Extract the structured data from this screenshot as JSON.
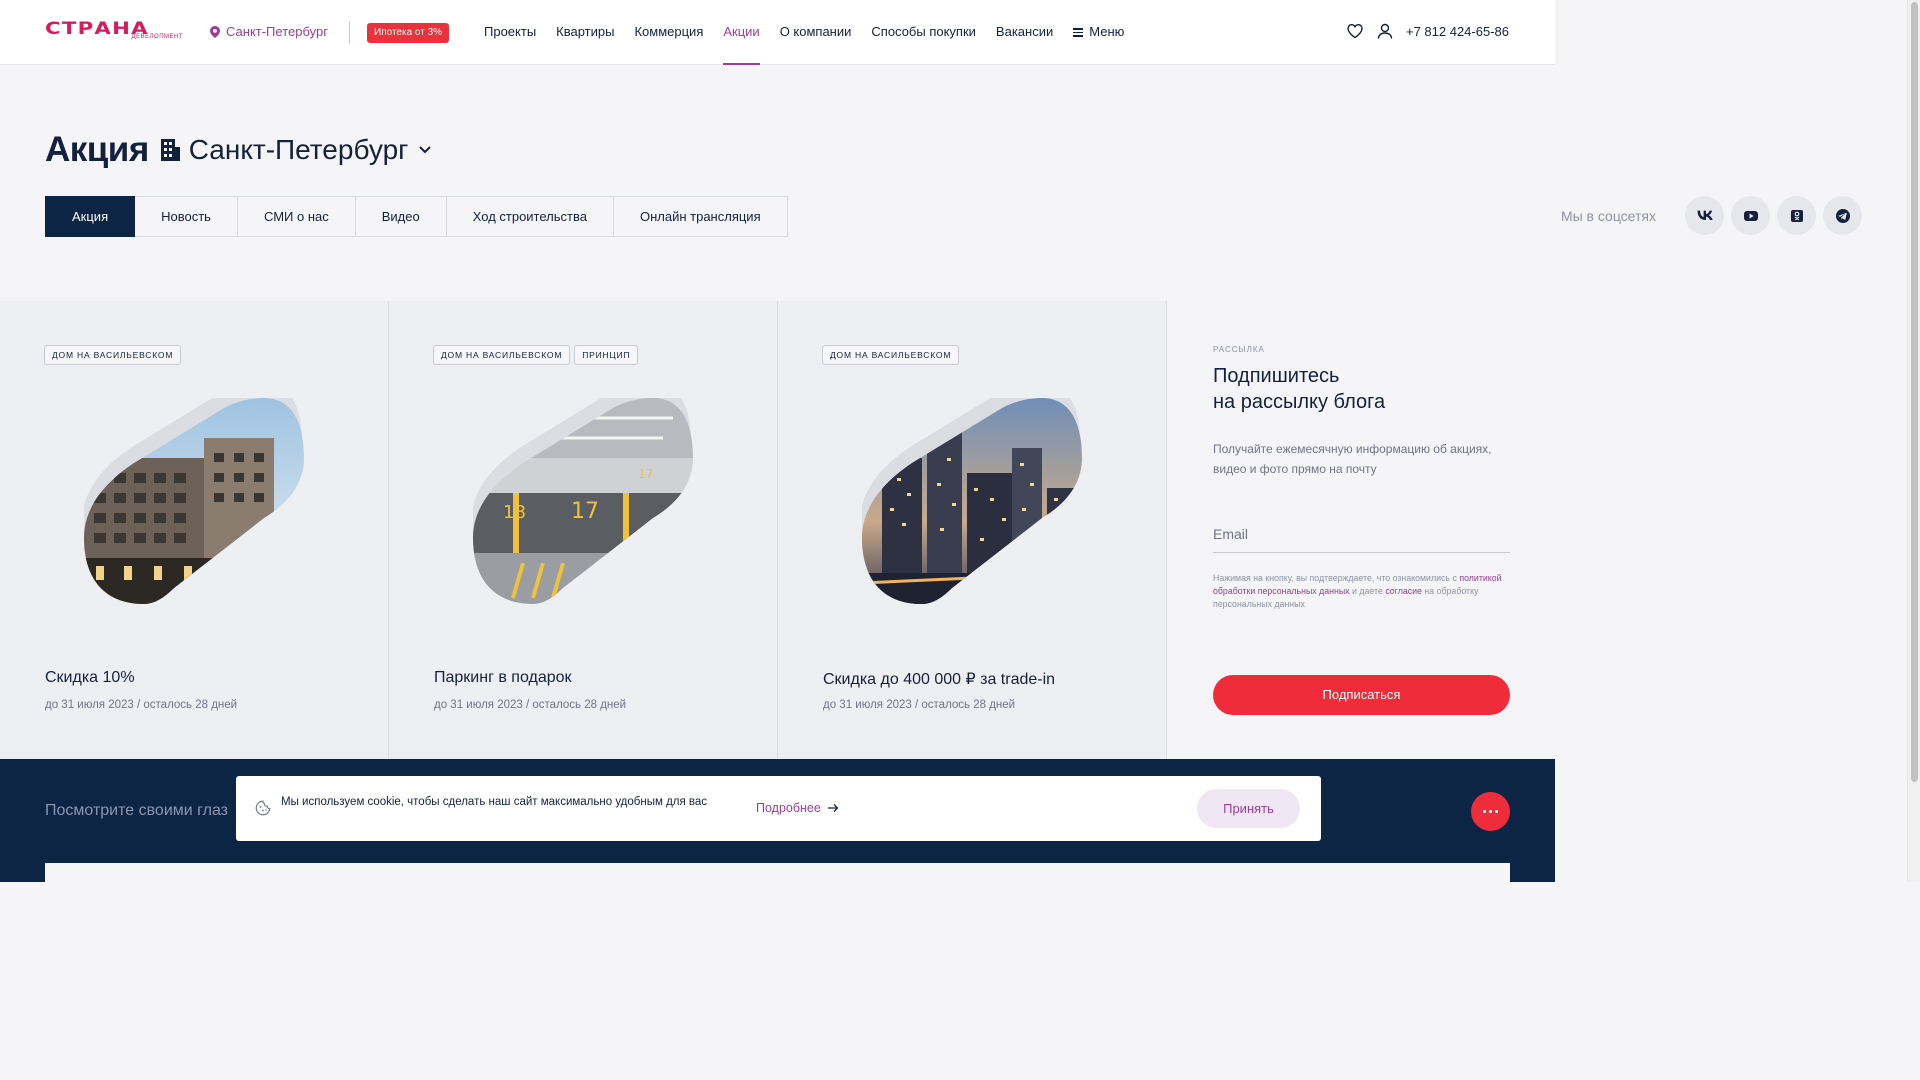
{
  "header": {
    "logo_word": "СТРАНА",
    "logo_sub": "ДЕВЕЛОПМЕНТ",
    "city": "Санкт-Петербург",
    "mortgage": "Ипотека от 3%",
    "nav": [
      {
        "label": "Проекты"
      },
      {
        "label": "Квартиры"
      },
      {
        "label": "Коммерция"
      },
      {
        "label": "Акции"
      },
      {
        "label": "О компании"
      },
      {
        "label": "Способы покупки"
      },
      {
        "label": "Вакансии"
      },
      {
        "label": "Меню"
      }
    ],
    "phone": "+7 812 424-65-86"
  },
  "page": {
    "title": "Акция",
    "city_select": "Санкт-Петербург"
  },
  "tabs": [
    {
      "label": "Акция"
    },
    {
      "label": "Новость"
    },
    {
      "label": "СМИ о нас"
    },
    {
      "label": "Видео"
    },
    {
      "label": "Ход строительства"
    },
    {
      "label": "Онлайн трансляция"
    }
  ],
  "social": {
    "label": "Мы в соцсетях",
    "icons": [
      "vk-icon",
      "youtube-icon",
      "odnoklassniki-icon",
      "telegram-icon"
    ]
  },
  "cards": [
    {
      "tags": [
        "ДОМ НА ВАСИЛЬЕВСКОМ"
      ],
      "title": "Скидка 10%",
      "date": "до 31 июля 2023 / осталось 28 дней"
    },
    {
      "tags": [
        "ДОМ НА ВАСИЛЬЕВСКОМ",
        "ПРИНЦИП"
      ],
      "title": "Паркинг в подарок",
      "date": "до 31 июля 2023 / осталось 28 дней"
    },
    {
      "tags": [
        "ДОМ НА ВАСИЛЬЕВСКОМ"
      ],
      "title": "Скидка до 400 000 ₽  за trade-in",
      "date": "до 31 июля 2023 / осталось 28 дней"
    }
  ],
  "subscribe": {
    "eyebrow": "РАССЫЛКА",
    "title_line1": "Подпишитесь",
    "title_line2": "на рассылку блога",
    "description": "Получайте ежемесячную информацию об акциях, видео и фото прямо на почту",
    "email_placeholder": "Email",
    "consent_pre": "Нажимая на кнопку, вы подтверждаете, что ознакомились с",
    "consent_link1": "политикой обработки персональных данных",
    "consent_mid": "и даете",
    "consent_link2": "согласие",
    "consent_post": "на обработку персональных данных",
    "button": "Подписаться"
  },
  "bottom": {
    "caption": "Посмотрите своими глаз"
  },
  "cookie": {
    "text": "Мы используем cookie, чтобы сделать наш сайт максимально удобным для вас",
    "more": "Подробнее",
    "accept": "Принять"
  },
  "colors": {
    "brand": "#d81a60",
    "accent": "#9b3f96",
    "navy": "#0d2545",
    "red": "#ef2d3a"
  }
}
